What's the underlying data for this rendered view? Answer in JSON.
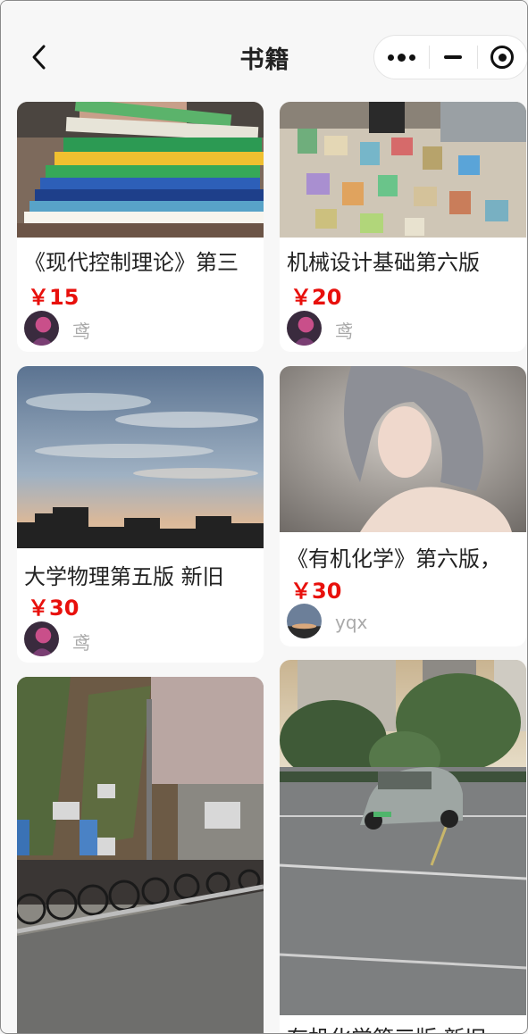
{
  "header": {
    "title": "书籍",
    "back_icon": "chevron-left-icon",
    "capsule_icons": [
      "more-dots-icon",
      "minimize-icon",
      "target-circle-icon"
    ]
  },
  "books": [
    {
      "title": "《现代控制理论》第三",
      "price": "￥15",
      "seller": "鸢",
      "image": "stack-of-textbooks-photo"
    },
    {
      "title": "机械设计基础第六版",
      "price": "￥20",
      "seller": "鸢",
      "image": "books-spread-on-floor-photo"
    },
    {
      "title": "大学物理第五版 新旧",
      "price": "￥30",
      "seller": "鸢",
      "image": "sunset-sky-photo"
    },
    {
      "title": "《有机化学》第六版，",
      "price": "￥30",
      "seller": "yqx",
      "image": "portrait-illustration-photo"
    },
    {
      "title": "",
      "price": "",
      "seller": "",
      "image": "bike-rack-street-photo"
    },
    {
      "title": "有机化学第三版 新旧",
      "price": "",
      "seller": "",
      "image": "car-parking-lot-photo"
    }
  ],
  "colors": {
    "price": "#e8100c",
    "background": "#f7f7f7",
    "seller": "#a9a9a9"
  }
}
